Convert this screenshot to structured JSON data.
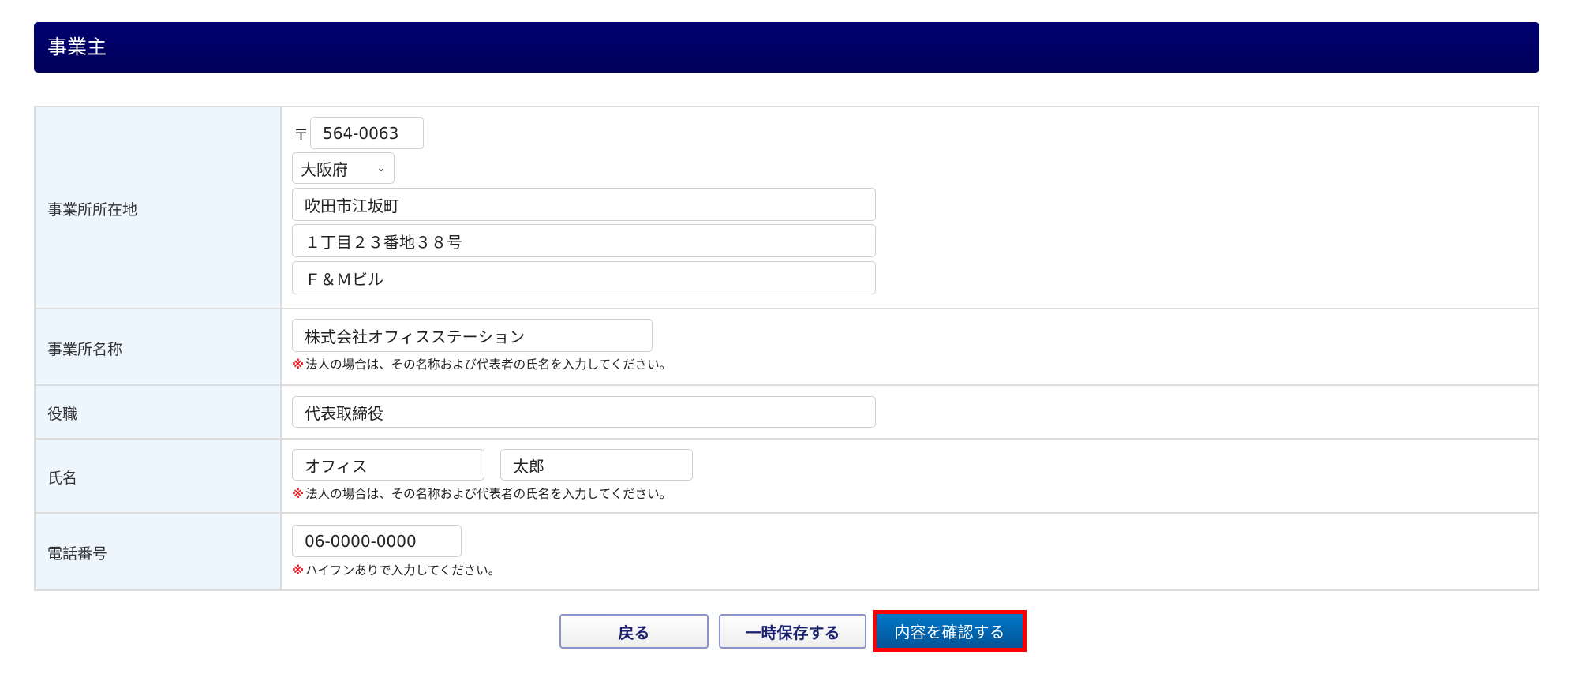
{
  "section_title": "事業主",
  "address": {
    "label": "事業所所在地",
    "postal_mark": "〒",
    "postal_code": "564-0063",
    "prefecture": "大阪府",
    "line1": "吹田市江坂町",
    "line2": "１丁目２３番地３８号",
    "line3": "Ｆ＆Ｍビル"
  },
  "company": {
    "label": "事業所名称",
    "value": "株式会社オフィスステーション",
    "note_mark": "※",
    "note": "法人の場合は、その名称および代表者の氏名を入力してください。"
  },
  "title": {
    "label": "役職",
    "value": "代表取締役"
  },
  "name": {
    "label": "氏名",
    "last": "オフィス",
    "first": "太郎",
    "note_mark": "※",
    "note": "法人の場合は、その名称および代表者の氏名を入力してください。"
  },
  "phone": {
    "label": "電話番号",
    "value": "06-0000-0000",
    "note_mark": "※",
    "note": "ハイフンありで入力してください。"
  },
  "buttons": {
    "back": "戻る",
    "save": "一時保存する",
    "confirm": "内容を確認する"
  }
}
